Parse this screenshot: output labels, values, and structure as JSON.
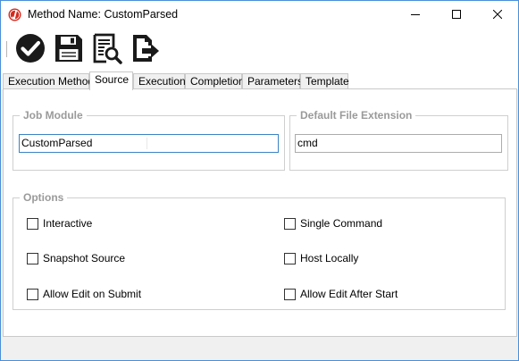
{
  "window": {
    "title": "Method Name: CustomParsed",
    "minimize_icon": "minimize-icon",
    "maximize_icon": "maximize-icon",
    "close_icon": "close-icon"
  },
  "toolbar": {
    "items": [
      {
        "name": "approve-button",
        "icon": "check-circle-icon"
      },
      {
        "name": "save-button",
        "icon": "floppy-disk-icon"
      },
      {
        "name": "preview-button",
        "icon": "document-search-icon"
      },
      {
        "name": "export-button",
        "icon": "document-export-icon"
      }
    ]
  },
  "tabs": [
    {
      "label": "Execution Method",
      "active": false
    },
    {
      "label": "Source",
      "active": true
    },
    {
      "label": "Execution",
      "active": false
    },
    {
      "label": "Completion",
      "active": false
    },
    {
      "label": "Parameters",
      "active": false
    },
    {
      "label": "Template",
      "active": false
    }
  ],
  "job_module": {
    "title": "Job Module",
    "value": "CustomParsed"
  },
  "default_extension": {
    "title": "Default File Extension",
    "value": "cmd"
  },
  "options": {
    "title": "Options",
    "items": [
      {
        "label": "Interactive",
        "checked": false
      },
      {
        "label": "Single Command",
        "checked": false
      },
      {
        "label": "Snapshot Source",
        "checked": false
      },
      {
        "label": "Host Locally",
        "checked": false
      },
      {
        "label": "Allow Edit on Submit",
        "checked": false
      },
      {
        "label": "Allow Edit After Start",
        "checked": false
      }
    ]
  },
  "colors": {
    "accent": "#3b83c4",
    "app_icon": "#d42a1e",
    "toolbar_icon": "#1a1a1a"
  }
}
